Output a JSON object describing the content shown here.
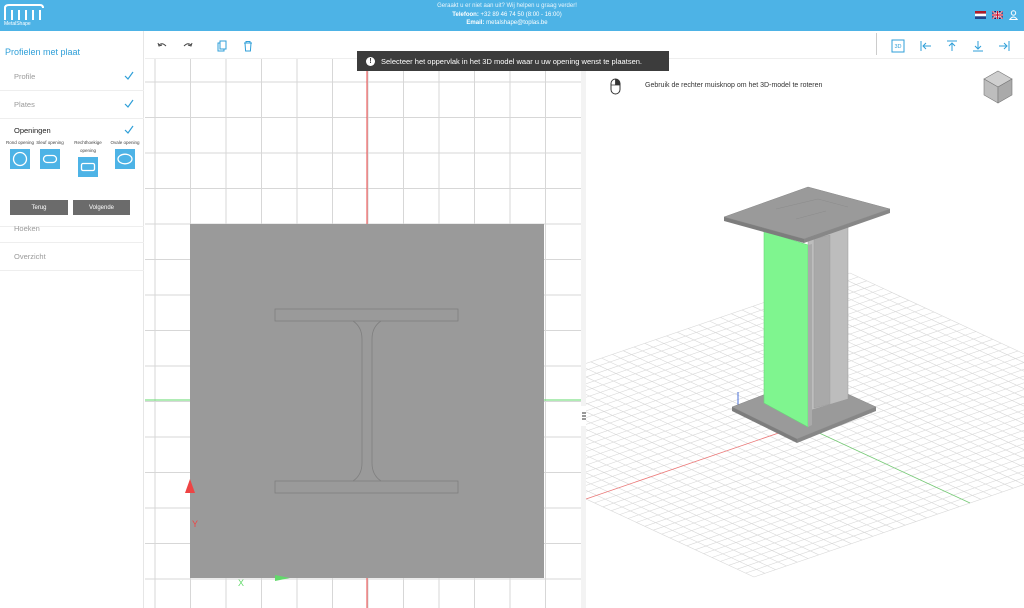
{
  "header": {
    "logo_text": "MetalShape",
    "contact_line1": "Geraakt u er niet aan uit? Wij helpen u graag verder!",
    "phone_label": "Telefoon:",
    "phone_value": "+32 89 46 74 50 (8:00 - 16:00)",
    "email_label": "Email:",
    "email_value": "metalshape@toplas.be"
  },
  "sidebar": {
    "title": "Profielen met plaat",
    "steps": [
      {
        "label": "Profile",
        "done": true
      },
      {
        "label": "Plates",
        "done": true
      },
      {
        "label": "Openingen",
        "done": true
      },
      {
        "label": "Hoeken",
        "done": false
      },
      {
        "label": "Overzicht",
        "done": false
      }
    ],
    "openings": [
      {
        "label": "Rond opening",
        "icon": "circle-opening-icon"
      },
      {
        "label": "Sleuf opening",
        "icon": "slot-opening-icon"
      },
      {
        "label": "Rechthoekige opening",
        "icon": "rectangle-opening-icon"
      },
      {
        "label": "Ovale opening",
        "icon": "oval-opening-icon"
      }
    ],
    "back_label": "Terug",
    "next_label": "Volgende"
  },
  "toast": {
    "text": "Selecteer het oppervlak in het 3D model waar u uw opening wenst te plaatsen."
  },
  "hint": {
    "text": "Gebruik de rechter muisknop om het 3D-model te roteren"
  },
  "view2d": {
    "axis_y": "Y",
    "axis_x": "X"
  },
  "view_toolbar": {
    "label_3d": "3D"
  },
  "colors": {
    "accent": "#4db3e6",
    "highlight_face": "#7ff58f",
    "plate": "#9a9a9a"
  }
}
